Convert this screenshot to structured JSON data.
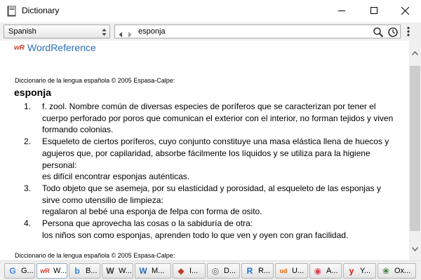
{
  "window": {
    "title": "Dictionary",
    "icon": "book-icon"
  },
  "toolbar": {
    "language": "Spanish",
    "search_value": "esponja",
    "icons": [
      "back-arrow-icon",
      "forward-arrow-icon",
      "search-icon",
      "history-icon",
      "menu-icon"
    ]
  },
  "content": {
    "source_name": "WordReference",
    "source_mark": "wR",
    "copyright": "Diccionario de la lengua española © 2005 Espasa-Calpe:",
    "copyright_2": "Diccionario de la lengua española © 2005 Espasa-Calpe:",
    "headword": "esponja",
    "definitions": [
      {
        "number": "1.",
        "text": "f. zool. Nombre común de diversas especies de poríferos que se caracterizan por tener el cuerpo perforado por poros que comunican el exterior con el interior, no forman tejidos y viven formando colonias."
      },
      {
        "number": "2.",
        "text": "Esqueleto de ciertos poríferos, cuyo conjunto constituye una masa elástica llena de huecos y agujeros que, por capilaridad, absorbe fácilmente los líquidos y se utiliza para la higiene personal:",
        "example": "es difícil encontrar esponjas auténticas."
      },
      {
        "number": "3.",
        "text": "Todo objeto que se asemeja, por su elasticidad y porosidad, al esqueleto de las esponjas y sirve como utensilio de limpieza:",
        "example": "regalaron al bebé una esponja de felpa con forma de osito."
      },
      {
        "number": "4.",
        "text": "Persona que aprovecha las cosas o la sabiduría de otra:",
        "example": "los niños son como esponjas, aprenden todo lo que ven y oyen con gran facilidad."
      }
    ]
  },
  "tabs": [
    {
      "label": "G...",
      "icon": "google-icon",
      "color": "#4285f4"
    },
    {
      "label": "W...",
      "icon": "wordreference-icon",
      "color": "#d43b2a"
    },
    {
      "label": "B...",
      "icon": "bing-icon",
      "color": "#2f7fd1"
    },
    {
      "label": "W...",
      "icon": "wikipedia-icon",
      "color": "#333333"
    },
    {
      "label": "M...",
      "icon": "merriam-webster-icon",
      "color": "#2f6bb5"
    },
    {
      "label": "I...",
      "icon": "shield-icon",
      "color": "#c0392b"
    },
    {
      "label": "D...",
      "icon": "dictionary-icon",
      "color": "#666666"
    },
    {
      "label": "R...",
      "icon": "reverso-icon",
      "color": "#1d6fd1"
    },
    {
      "label": "U...",
      "icon": "urban-dictionary-icon",
      "color": "#e86a10"
    },
    {
      "label": "A...",
      "icon": "app-icon",
      "color": "#e04050"
    },
    {
      "label": "Y...",
      "icon": "yandex-icon",
      "color": "#e61400"
    },
    {
      "label": "Ox...",
      "icon": "oxford-icon",
      "color": "#3a7d3a"
    }
  ]
}
